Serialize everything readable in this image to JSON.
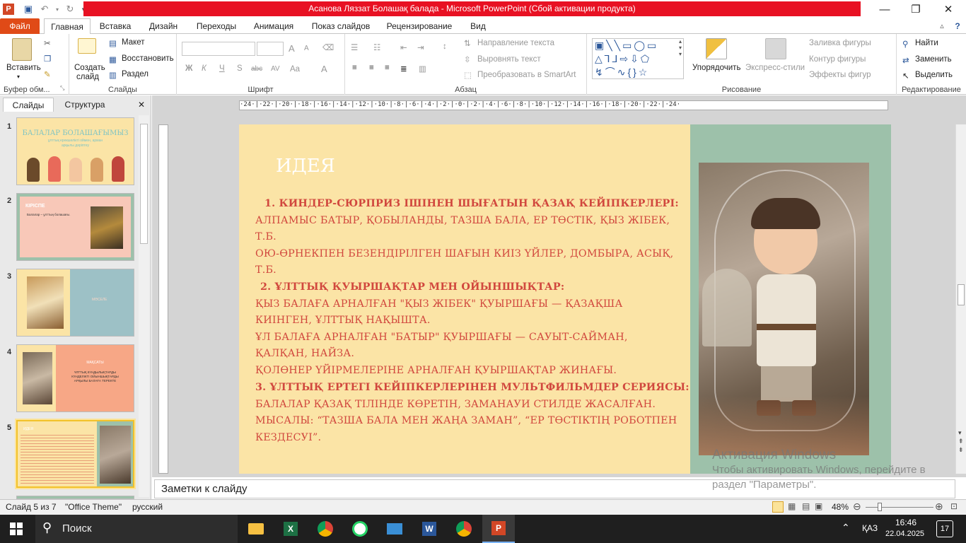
{
  "window": {
    "title": "Асанова Ляззат Болашақ балада  -  Microsoft PowerPoint (Сбой активации продукта)",
    "controls": {
      "minimize": "—",
      "restore": "❐",
      "close": "✕"
    }
  },
  "tabs": [
    "Файл",
    "Главная",
    "Вставка",
    "Дизайн",
    "Переходы",
    "Анимация",
    "Показ слайдов",
    "Рецензирование",
    "Вид"
  ],
  "ribbon": {
    "clipboard": {
      "paste": "Вставить",
      "group": "Буфер обм..."
    },
    "slides": {
      "new_slide": "Создать",
      "new_slide2": "слайд",
      "layout": "Макет",
      "reset": "Восстановить",
      "section": "Раздел",
      "group": "Слайды"
    },
    "font": {
      "bold": "Ж",
      "italic": "К",
      "underline": "Ч",
      "shadow": "S",
      "strike": "abc",
      "spacing": "AV",
      "case": "Aa",
      "color": "A",
      "grow": "A",
      "shrink": "A",
      "group": "Шрифт"
    },
    "paragraph": {
      "direction": "Направление текста",
      "align": "Выровнять текст",
      "smartart": "Преобразовать в SmartArt",
      "group": "Абзац"
    },
    "drawing": {
      "arrange": "Упорядочить",
      "quickstyles": "Экспресс-стили",
      "fill": "Заливка фигуры",
      "outline": "Контур фигуры",
      "effects": "Эффекты фигур",
      "group": "Рисование"
    },
    "editing": {
      "find": "Найти",
      "replace": "Заменить",
      "select": "Выделить",
      "group": "Редактирование"
    }
  },
  "pane": {
    "tab_slides": "Слайды",
    "tab_outline": "Структура",
    "close": "✕",
    "thumbs": [
      {
        "num": "1",
        "title": "БАЛАЛАР БОЛАШАҒЫМЫЗ",
        "sub": "ұлттық ерекшелікті оймен, арман арқылы дәріптеу"
      },
      {
        "num": "2",
        "title": "КІРІСПЕ",
        "sub": "Балалар – ұлттың болашағы."
      },
      {
        "num": "3",
        "title": "МӘСЕЛЕ",
        "sub": ""
      },
      {
        "num": "4",
        "title": "МАҚСАТЫ",
        "sub": "ҰЛТТЫҚ КҮНДЫЛЫҚТАРДЫ КҮНДЕЛІКТІ ОЙЫНШЫҚТАРДЫ АРҚЫЛЫ БАЛАҒА ТЕРЕКТЕ"
      },
      {
        "num": "5",
        "title": "ИДЕЯ",
        "sub": ""
      }
    ]
  },
  "slide": {
    "title": "ИДЕЯ",
    "lines": [
      "1. КИНДЕР-СЮРПРИЗ ІШІНЕН ШЫҒАТЫН ҚАЗАҚ КЕЙІПКЕРЛЕРІ:",
      "АЛПАМЫС БАТЫР, ҚОБЫЛАНДЫ, ТАЗША БАЛА, ЕР ТӨСТІК, ҚЫЗ ЖІБЕК,",
      "Т.Б.",
      "ОЮ-ӨРНЕКПЕН БЕЗЕНДІРІЛГЕН ШАҒЫН КИІЗ ҮЙЛЕР, ДОМБЫРА, АСЫҚ,",
      "Т.Б.",
      "2. ҰЛТТЫҚ ҚУЫРШАҚТАР МЕН ОЙЫНШЫҚТАР:",
      "ҚЫЗ БАЛАҒА АРНАЛҒАН \"ҚЫЗ ЖІБЕК\" ҚУЫРШАҒЫ — ҚАЗАҚША",
      "КИІНГЕН, ҰЛТТЫҚ НАҚЫШТА.",
      "ҰЛ БАЛАҒА АРНАЛҒАН \"БАТЫР\" ҚУЫРШАҒЫ — САУЫТ-САЙМАН,",
      "ҚАЛҚАН, НАЙЗА.",
      "ҚОЛӨНЕР ҮЙІРМЕЛЕРІНЕ АРНАЛҒАН ҚУЫРШАҚТАР ЖИНАҒЫ.",
      "3. ҰЛТТЫҚ ЕРТЕГІ КЕЙІПКЕРЛЕРІНЕН МУЛЬТФИЛЬМДЕР СЕРИЯСЫ:",
      "БАЛАЛАР ҚАЗАҚ ТІЛІНДЕ КӨРЕТІН, ЗАМАНАУИ СТИЛДЕ ЖАСАЛҒАН.",
      "МЫСАЛЫ: “ТАЗША БАЛА МЕН ЖАҢА ЗАМАН”, “ЕР ТӨСТІКТІҢ РОБОТПЕН",
      "КЕЗДЕСУІ”."
    ]
  },
  "ruler": {
    "h": "·24·|·22·|·20·|·18·|·16·|·14·|·12·|·10·|·8·|·6·|·4·|·2·|·0·|·2·|·4·|·6·|·8·|·10·|·12·|·14·|·16·|·18·|·20·|·22·|·24·"
  },
  "notes": {
    "placeholder": "Заметки к слайду"
  },
  "watermark": {
    "line1": "Активация Windows",
    "line2": "Чтобы активировать Windows, перейдите в",
    "line3": "раздел \"Параметры\"."
  },
  "status": {
    "slide": "Слайд 5 из 7",
    "theme": "\"Office Theme\"",
    "lang": "русский",
    "zoom": "48%",
    "zoom_fraction": 0.48
  },
  "taskbar": {
    "search": "Поиск",
    "lang": "ҚАЗ",
    "time": "16:46",
    "date": "22.04.2025",
    "notif": "17"
  },
  "colors": {
    "accent_red": "#e81123",
    "file_tab": "#e04a17",
    "slide_bg": "#fbe4a6",
    "slide_right": "#9dc1aa",
    "body_text": "#d1483e"
  }
}
